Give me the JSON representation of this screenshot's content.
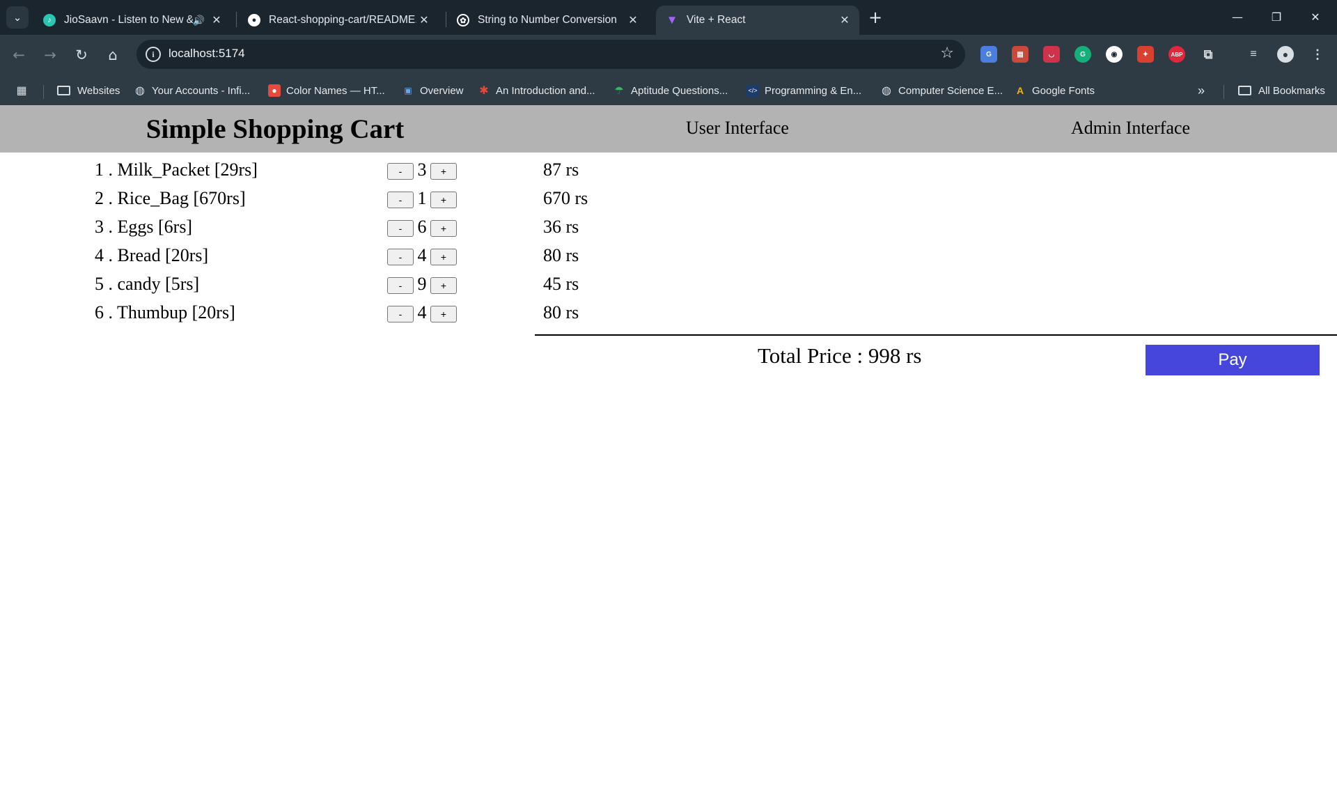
{
  "browser": {
    "tabs": [
      {
        "title": "JioSaavn - Listen to New &",
        "favicon": "jiosaavn-icon",
        "color": "#2bc5b4",
        "playing": true
      },
      {
        "title": "React-shopping-cart/README.m",
        "favicon": "github-icon",
        "color": "#ffffff"
      },
      {
        "title": "String to Number Conversion",
        "favicon": "openai-icon",
        "color": "#ffffff"
      },
      {
        "title": "Vite + React",
        "favicon": "vite-icon",
        "color": "#a463ff",
        "active": true
      }
    ],
    "url": "localhost:5174",
    "bookmarks": [
      {
        "label": "Websites",
        "icon": "folder-icon"
      },
      {
        "label": "Your Accounts - Infi...",
        "icon": "globe-icon"
      },
      {
        "label": "Color Names — HT...",
        "icon": "color-icon"
      },
      {
        "label": "Overview",
        "icon": "car-icon"
      },
      {
        "label": "An Introduction and...",
        "icon": "asterisk-icon"
      },
      {
        "label": "Aptitude Questions...",
        "icon": "umbrella-icon"
      },
      {
        "label": "Programming & En...",
        "icon": "code-icon"
      },
      {
        "label": "Computer Science E...",
        "icon": "globe-icon"
      },
      {
        "label": "Google Fonts",
        "icon": "google-fonts-icon"
      }
    ],
    "all_bookmarks": "All Bookmarks"
  },
  "app": {
    "title": "Simple Shopping Cart",
    "nav": {
      "user": "User Interface",
      "admin": "Admin Interface"
    },
    "items": [
      {
        "label": "1 . Milk_Packet [29rs]",
        "qty": "3",
        "subtotal": "87 rs"
      },
      {
        "label": "2 . Rice_Bag [670rs]",
        "qty": "1",
        "subtotal": "670 rs"
      },
      {
        "label": "3 . Eggs [6rs]",
        "qty": "6",
        "subtotal": "36 rs"
      },
      {
        "label": "4 . Bread [20rs]",
        "qty": "4",
        "subtotal": "80 rs"
      },
      {
        "label": "5 . candy [5rs]",
        "qty": "9",
        "subtotal": "45 rs"
      },
      {
        "label": "6 . Thumbup [20rs]",
        "qty": "4",
        "subtotal": "80 rs"
      }
    ],
    "minus_label": "-",
    "plus_label": "+",
    "total": "Total Price : 998 rs",
    "pay_label": "Pay",
    "pay_color": "#4646dc",
    "header_color": "#b3b3b3"
  }
}
